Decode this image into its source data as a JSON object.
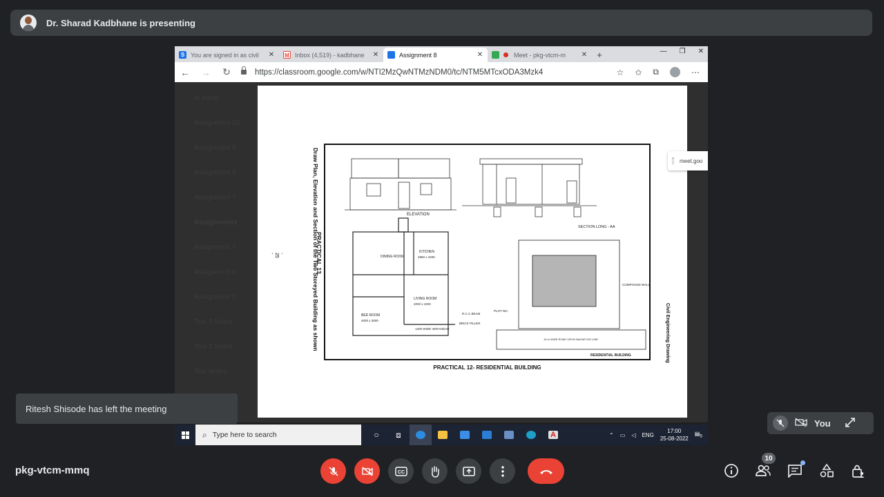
{
  "presenter_bar": {
    "text": "Dr. Sharad Kadbhane is presenting"
  },
  "browser": {
    "tabs": [
      {
        "label": "You are signed in as civil",
        "favicon": "S",
        "color": "#1a73e8"
      },
      {
        "label": "Inbox (4,519) - kadbhane",
        "favicon": "M",
        "color": "#ea4335"
      },
      {
        "label": "Assignment 8",
        "favicon": "",
        "color": "#1a73e8",
        "active": true
      },
      {
        "label": "Meet - pkg-vtcm-m",
        "favicon": "",
        "color": "#34a853"
      }
    ],
    "url": "https://classroom.google.com/w/NTI2MzQwNTMzNDM0/tc/NTM5MTcxODA3Mzk4",
    "popout_label": "meet.goo"
  },
  "classroom_list": [
    "In batch",
    "Assignment 10",
    "Assignment 9",
    "Assignment 8",
    "Assignment 7",
    "Assignments",
    "Assignment 7",
    "Assignment 6",
    "Assignment 5",
    "Test 1 Notes",
    "Test 1 Notes",
    "Test Notes"
  ],
  "document": {
    "vertical_title": "Draw Plan, Elevation and Section of the Two Storeyed Building as shown",
    "practical_label": "PRACTICAL 13",
    "page_number": "- 25 -",
    "side_label": "Civil Engineering Drawing",
    "caption": "PRACTICAL 12- RESIDENTIAL BUILDING",
    "drawing_labels": {
      "elevation": "ELEVATION",
      "section": "SECTION LONG - AA",
      "dining": "DINING ROOM",
      "kitchen": "KITCHEN",
      "kitchen_size": "2850 x 3400",
      "living": "LIVING ROOM",
      "living_size": "4000 x 4200",
      "bed": "BED ROOM",
      "bed_size": "4000 x 3500",
      "verandah": "1200 WIDE VERANDAH",
      "rcc_beam": "R.C.C BEAM",
      "brick_pillar": "BRICK PILLER",
      "compound_wall": "COMPOUND WALL",
      "road": "10 m WIDE ROAD VIDYA NAGAR SIG LINE",
      "residential": "RESIDENTIAL BUILDING",
      "plot_no": "PLOT NO."
    }
  },
  "taskbar": {
    "search_placeholder": "Type here to search",
    "lang": "ENG",
    "time": "17:00",
    "date": "25-08-2022",
    "notif": "5"
  },
  "toast": {
    "text": "Ritesh Shisode has left the meeting"
  },
  "self_tile": {
    "label": "You"
  },
  "meeting_code": "pkg-vtcm-mmq",
  "participants_count": "10",
  "colors": {
    "danger": "#ea4335",
    "surface": "#3c4043",
    "background": "#202124"
  }
}
